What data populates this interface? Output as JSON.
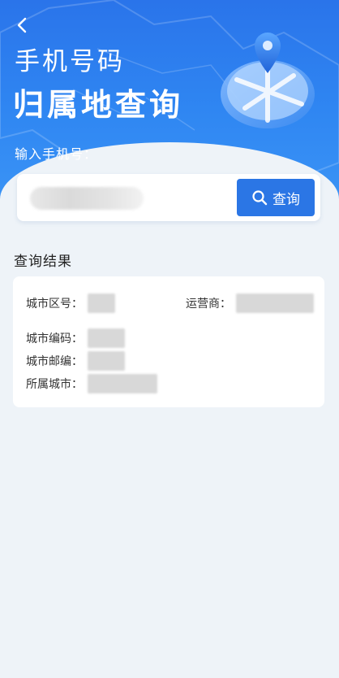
{
  "header": {
    "back_icon": "chevron-left-icon",
    "title_line1": "手机号码",
    "title_line2": "归属地查询",
    "illustration_icon": "location-pin-map-icon"
  },
  "search": {
    "label": "输入手机号：",
    "phone_value": "",
    "button_label": "查询",
    "button_icon": "search-icon"
  },
  "results": {
    "title": "查询结果",
    "fields": {
      "area_code_label": "城市区号：",
      "carrier_label": "运营商：",
      "city_code_label": "城市编码：",
      "postal_code_label": "城市邮编：",
      "city_label": "所属城市："
    }
  },
  "colors": {
    "primary": "#2b76e5",
    "background": "#eef3f8"
  }
}
